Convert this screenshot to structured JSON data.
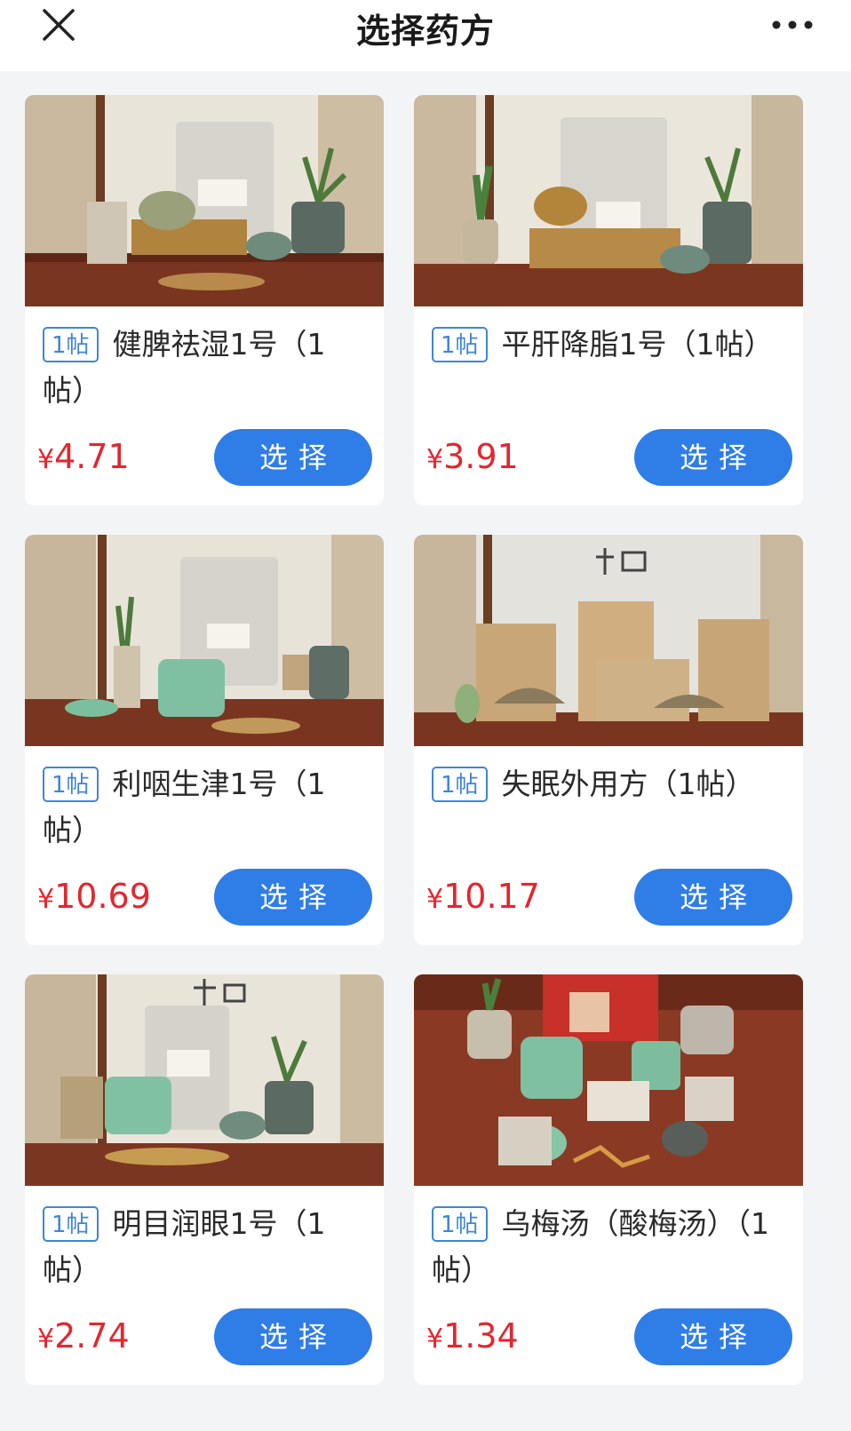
{
  "header": {
    "title": "选择药方",
    "close_icon": "close-icon",
    "more_icon": "more-dots-icon"
  },
  "colors": {
    "badge": "#3f86d8",
    "price": "#e3262f",
    "button": "#2f7de7"
  },
  "products": [
    {
      "badge": "1帖",
      "name": "健脾祛湿1号（1帖）",
      "currency": "¥",
      "price": "4.71",
      "button": "选择"
    },
    {
      "badge": "1帖",
      "name": "平肝降脂1号（1帖）",
      "currency": "¥",
      "price": "3.91",
      "button": "选择"
    },
    {
      "badge": "1帖",
      "name": "利咽生津1号（1帖）",
      "currency": "¥",
      "price": "10.69",
      "button": "选择"
    },
    {
      "badge": "1帖",
      "name": "失眠外用方（1帖）",
      "currency": "¥",
      "price": "10.17",
      "button": "选择"
    },
    {
      "badge": "1帖",
      "name": "明目润眼1号（1帖）",
      "currency": "¥",
      "price": "2.74",
      "button": "选择"
    },
    {
      "badge": "1帖",
      "name": "乌梅汤（酸梅汤）（1帖）",
      "currency": "¥",
      "price": "1.34",
      "button": "选择"
    }
  ]
}
